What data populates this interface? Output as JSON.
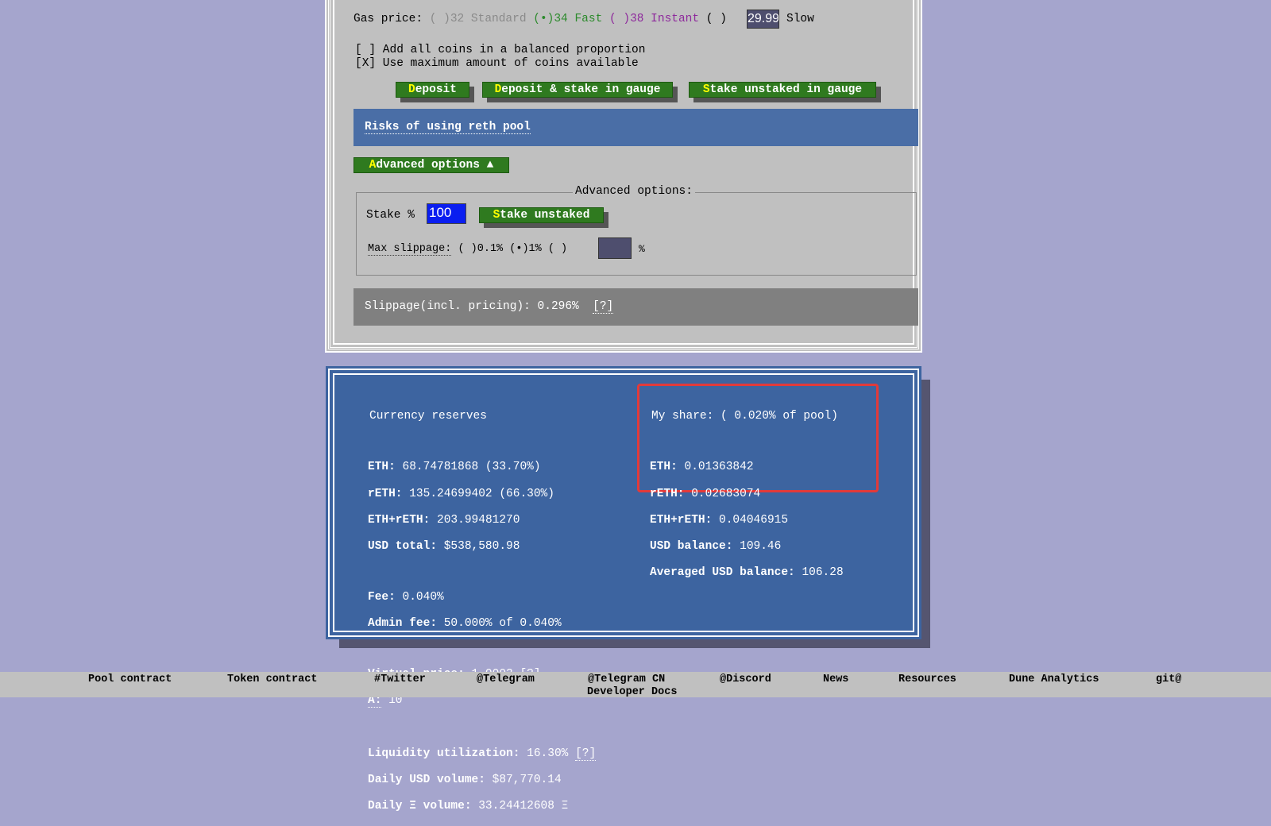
{
  "gas": {
    "label": "Gas price:",
    "standard": "( )32 Standard",
    "fast": "(•)34 Fast",
    "instant": "( )38 Instant",
    "custom_radio": "( )",
    "custom_value": "29.99",
    "slow": "Slow"
  },
  "options": {
    "balanced": "[ ] Add all coins in a balanced proportion",
    "max": "[X] Use maximum amount of coins available"
  },
  "buttons": {
    "deposit_k": "D",
    "deposit": "eposit",
    "deposit_stake_k": "D",
    "deposit_stake": "eposit & stake in gauge",
    "stake_gauge_k": "S",
    "stake_gauge": "take unstaked in gauge"
  },
  "risks": "Risks of using reth pool",
  "advanced": {
    "toggle_k": "A",
    "toggle": "dvanced options ▲",
    "legend": "Advanced options:",
    "stake_label": "Stake %",
    "stake_value": "100",
    "stake_btn_k": "S",
    "stake_btn": "take unstaked",
    "slippage_label": "Max slippage:",
    "slippage_opts": "( )0.1% (•)1% ( )",
    "slippage_custom": "",
    "pct": "%"
  },
  "slippage": {
    "text": "Slippage(incl. pricing): 0.296%",
    "help": "[?]"
  },
  "reserves": {
    "title": "Currency reserves",
    "eth_l": "ETH:",
    "eth": "68.74781868 (33.70%)",
    "reth_l": "rETH:",
    "reth": "135.24699402 (66.30%)",
    "sum_l": "ETH+rETH:",
    "sum": "203.99481270",
    "usd_l": "USD total:",
    "usd": "$538,580.98",
    "fee_l": "Fee:",
    "fee": "0.040%",
    "admin_l": "Admin fee:",
    "admin": "50.000% of 0.040%",
    "vp_l": "Virtual price:",
    "vp": "1.0003",
    "vp_help": "[?]",
    "a_l": "A:",
    "a": "10",
    "lu_l": "Liquidity utilization:",
    "lu": "16.30%",
    "lu_help": "[?]",
    "dusd_l": "Daily USD volume:",
    "dusd": "$87,770.14",
    "deth_l": "Daily Ξ volume:",
    "deth": "33.24412608 Ξ"
  },
  "share": {
    "title": "My share: ( 0.020% of pool)",
    "eth_l": "ETH:",
    "eth": "0.01363842",
    "reth_l": "rETH:",
    "reth": "0.02683074",
    "sum_l": "ETH+rETH:",
    "sum": "0.04046915",
    "usd_l": "USD balance:",
    "usd": "109.46",
    "avg_l": "Averaged USD balance:",
    "avg": "106.28"
  },
  "footer": [
    "Pool contract",
    "Token contract",
    "#Twitter",
    "@Telegram",
    "@Telegram CN",
    "@Discord",
    "News",
    "Resources",
    "Dune Analytics",
    "git@",
    "Developer Docs"
  ]
}
